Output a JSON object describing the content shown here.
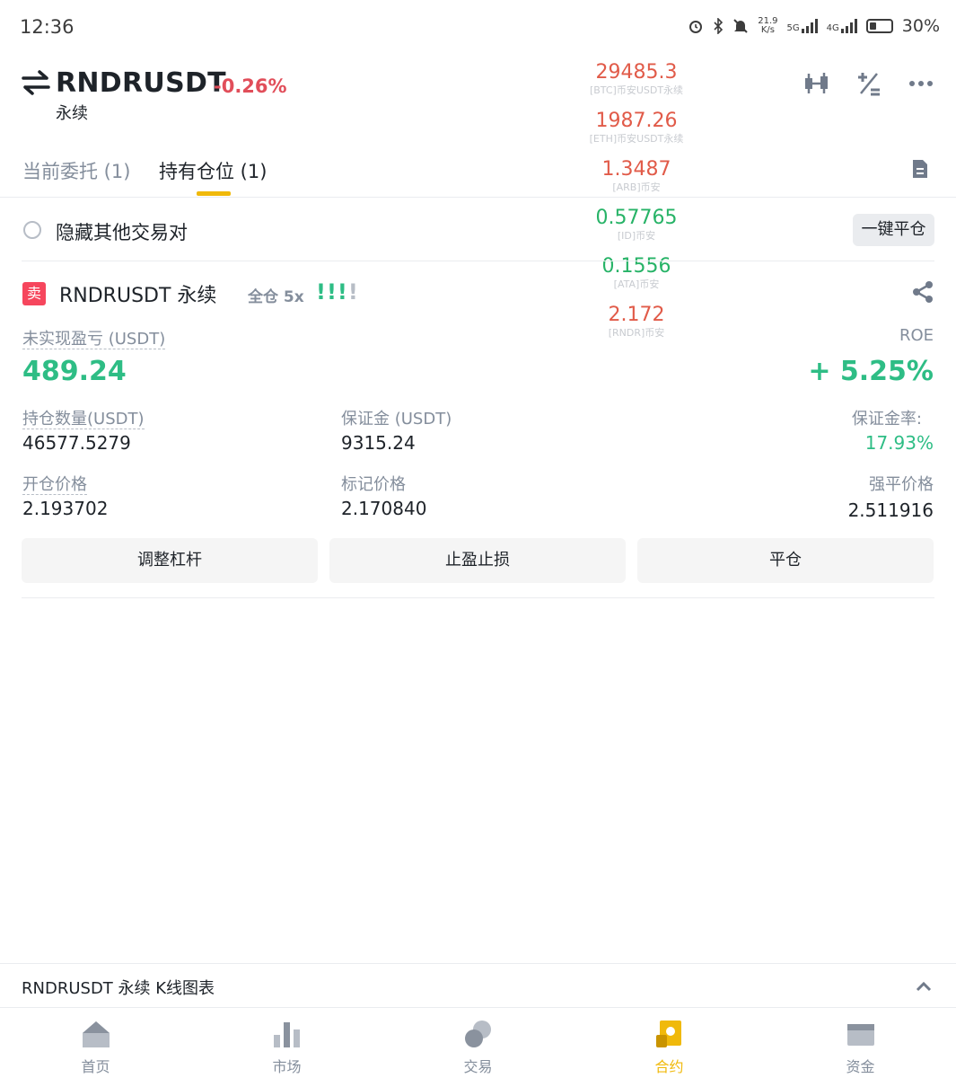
{
  "status_bar": {
    "time": "12:36",
    "net_speed_value": "21.9",
    "net_speed_unit": "K/s",
    "network_5g": "5G",
    "network_4g": "4G",
    "battery": "30%"
  },
  "header": {
    "symbol": "RNDRUSDT",
    "change": "-0.26%",
    "contract_type": "永续"
  },
  "tickers": [
    {
      "price": "29485.3",
      "label": "[BTC]币安USDT永续",
      "color": "red"
    },
    {
      "price": "1987.26",
      "label": "[ETH]币安USDT永续",
      "color": "red"
    },
    {
      "price": "1.3487",
      "label": "[ARB]币安",
      "color": "red"
    },
    {
      "price": "0.57765",
      "label": "[ID]币安",
      "color": "green"
    },
    {
      "price": "0.1556",
      "label": "[ATA]币安",
      "color": "green"
    },
    {
      "price": "2.172",
      "label": "[RNDR]币安",
      "color": "red"
    }
  ],
  "tabs": {
    "open_orders": "当前委托 (1)",
    "positions": "持有仓位 (1)"
  },
  "filter": {
    "hide_label": "隐藏其他交易对",
    "close_all": "一键平仓"
  },
  "position": {
    "side_badge": "卖",
    "title": "RNDRUSDT 永续",
    "margin_mode": "全仓 5x",
    "signal": "!!!!",
    "pnl_label": "未实现盈亏 (USDT)",
    "pnl_value": "489.24",
    "roe_label": "ROE",
    "roe_value": "+ 5.25%",
    "size_label": "持仓数量(USDT)",
    "size_value": "46577.5279",
    "margin_label": "保证金 (USDT)",
    "margin_value": "9315.24",
    "margin_ratio_label": "保证金率:",
    "margin_ratio_value": "17.93%",
    "entry_label": "开仓价格",
    "entry_value": "2.193702",
    "mark_label": "标记价格",
    "mark_value": "2.170840",
    "liq_label": "强平价格",
    "liq_value": "2.511916",
    "btn_leverage": "调整杠杆",
    "btn_tpsl": "止盈止损",
    "btn_close": "平仓"
  },
  "kline": {
    "label": "RNDRUSDT 永续  K线图表"
  },
  "bottom_nav": [
    {
      "label": "首页",
      "icon": "home-icon"
    },
    {
      "label": "市场",
      "icon": "market-icon"
    },
    {
      "label": "交易",
      "icon": "trade-icon"
    },
    {
      "label": "合约",
      "icon": "futures-icon",
      "active": true
    },
    {
      "label": "资金",
      "icon": "wallet-icon"
    }
  ],
  "colors": {
    "accent": "#f0b90b",
    "up": "#2ebd85",
    "down": "#f6465d"
  }
}
